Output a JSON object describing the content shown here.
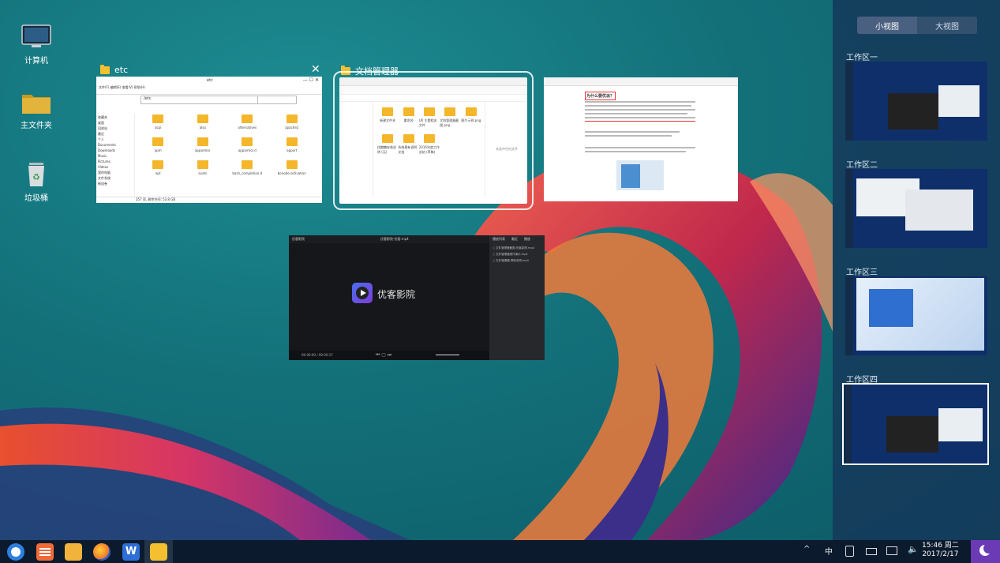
{
  "desktop_icons": [
    {
      "label": "计算机",
      "icon": "computer-icon"
    },
    {
      "label": "主文件夹",
      "icon": "home-folder-icon"
    },
    {
      "label": "垃圾桶",
      "icon": "trash-icon"
    }
  ],
  "windows": {
    "etc": {
      "title": "etc",
      "path": "/etc",
      "menu": "文件(F)   编辑(E)   查看(V)   帮助(H)",
      "side": [
        "收藏夹",
        "桌面",
        "回收站",
        "最近",
        "个人",
        "Documents",
        "Downloads",
        "Music",
        "Pictures",
        "Videos",
        "我的电脑",
        "文件系统",
        "新加卷"
      ],
      "files": [
        "acpi",
        "alsa",
        "alternatives",
        "apache2",
        "apm",
        "apparmor",
        "apparmor.d",
        "apport",
        "apt",
        "avahi",
        "bash_completion.d",
        "bonobo-activation"
      ],
      "status": "257 项, 剩余空间: 53.8 GB"
    },
    "fm": {
      "title": "文档管理器",
      "files": [
        "新建文件夹",
        "重命名",
        "UK 主题相关文件",
        "文档管理器截图.png",
        "图片示例.png",
        "优麒麟安装说明 (无)",
        "系统更新说明文档",
        "2016年度工作总结 (草稿)"
      ],
      "note": "未选中任何文件"
    },
    "doc": {
      "heading": "为什么要优派？"
    },
    "video": {
      "app": "优客影院",
      "title": "优客影院-优客.mp4",
      "logo_text": "优客影院",
      "time": "00:00:00 / 00:00:17",
      "tabs": [
        "播放列表",
        "最近",
        "播放"
      ],
      "playlist": [
        "文件管理器截图-优客影院.mp4",
        "文件管理器操作演示.mp4",
        "文件管理器-帮助说明.mp4"
      ]
    }
  },
  "panel": {
    "tabs": [
      "小视图",
      "大视图"
    ],
    "workspaces": [
      "工作区一",
      "工作区二",
      "工作区三",
      "工作区四"
    ]
  },
  "taskbar": {
    "apps": [
      "start-menu-icon",
      "app-grid-icon",
      "file-manager-icon",
      "firefox-icon",
      "wps-writer-icon",
      "folder-icon"
    ],
    "tray": {
      "chevron": "^",
      "ime": "中"
    },
    "clock_time": "15:46 周二",
    "clock_date": "2017/2/17"
  }
}
